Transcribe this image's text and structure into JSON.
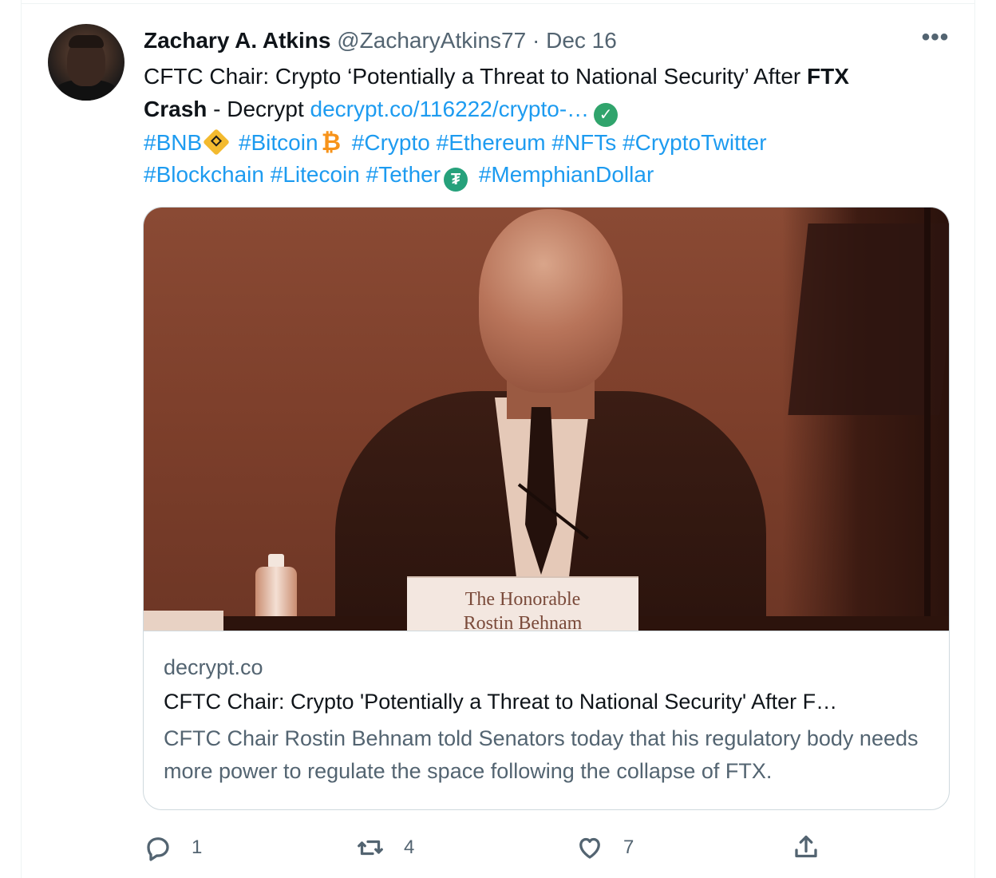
{
  "tweet": {
    "name": "Zachary A. Atkins",
    "handle": "@ZacharyAtkins77",
    "separator": "·",
    "date": "Dec 16",
    "text_part1": "CFTC Chair: Crypto ‘Potentially a Threat to National Security’ After ",
    "text_bold1": "FTX",
    "text_bold2": "Crash",
    "text_part2": " - Decrypt ",
    "link": "decrypt.co/116222/crypto-…",
    "hashtags": {
      "bnb": "#BNB",
      "bitcoin": "#Bitcoin",
      "crypto": "#Crypto",
      "ethereum": "#Ethereum",
      "nfts": "#NFTs",
      "cryptotwitter": "#CryptoTwitter",
      "blockchain": "#Blockchain",
      "litecoin": "#Litecoin",
      "tether": "#Tether",
      "memphian": "#MemphianDollar"
    },
    "emoji": {
      "check": "✓",
      "btc": "₿",
      "usdt": "₮"
    }
  },
  "card": {
    "placard_line1": "The Honorable",
    "placard_line2": "Rostin Behnam",
    "domain": "decrypt.co",
    "title": "CFTC Chair: Crypto 'Potentially a Threat to National Security' After F…",
    "description": "CFTC Chair Rostin Behnam told Senators today that his regulatory body needs more power to regulate the space following the collapse of FTX."
  },
  "actions": {
    "reply_count": "1",
    "retweet_count": "4",
    "like_count": "7"
  },
  "more_label": "•••",
  "colors": {
    "link": "#1d9bf0",
    "muted": "#536471",
    "text": "#0f1419",
    "border": "#cfd9de"
  }
}
